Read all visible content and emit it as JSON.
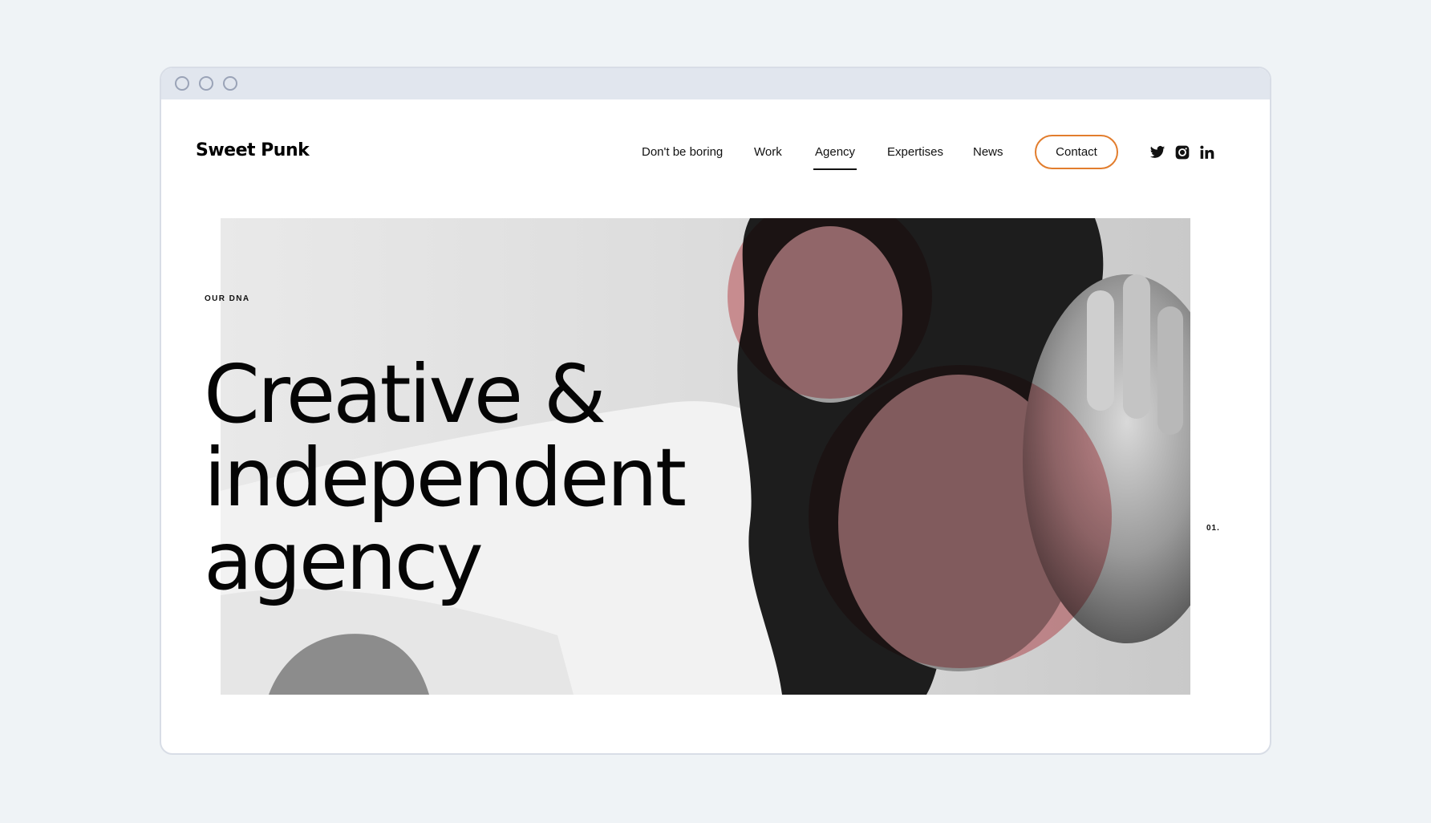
{
  "window": {
    "controls": [
      "close",
      "minimize",
      "maximize"
    ]
  },
  "header": {
    "logo": "Sweet Punk",
    "nav": [
      {
        "label": "Don't be boring",
        "active": false
      },
      {
        "label": "Work",
        "active": false
      },
      {
        "label": "Agency",
        "active": true
      },
      {
        "label": "Expertises",
        "active": false
      },
      {
        "label": "News",
        "active": false
      }
    ],
    "contact_label": "Contact",
    "social_icons": [
      "twitter-icon",
      "instagram-icon",
      "linkedin-icon"
    ]
  },
  "hero": {
    "eyebrow": "OUR DNA",
    "headline_lines": [
      "Creative &",
      "independent",
      "agency"
    ],
    "slide_number": "01.",
    "image": "black-and-white photo of a woman with curly hair reaching toward the camera",
    "overlay_color": "#e8a3a7"
  },
  "colors": {
    "page_background": "#eff3f6",
    "accent_border": "#e27d2d",
    "text": "#111111"
  }
}
